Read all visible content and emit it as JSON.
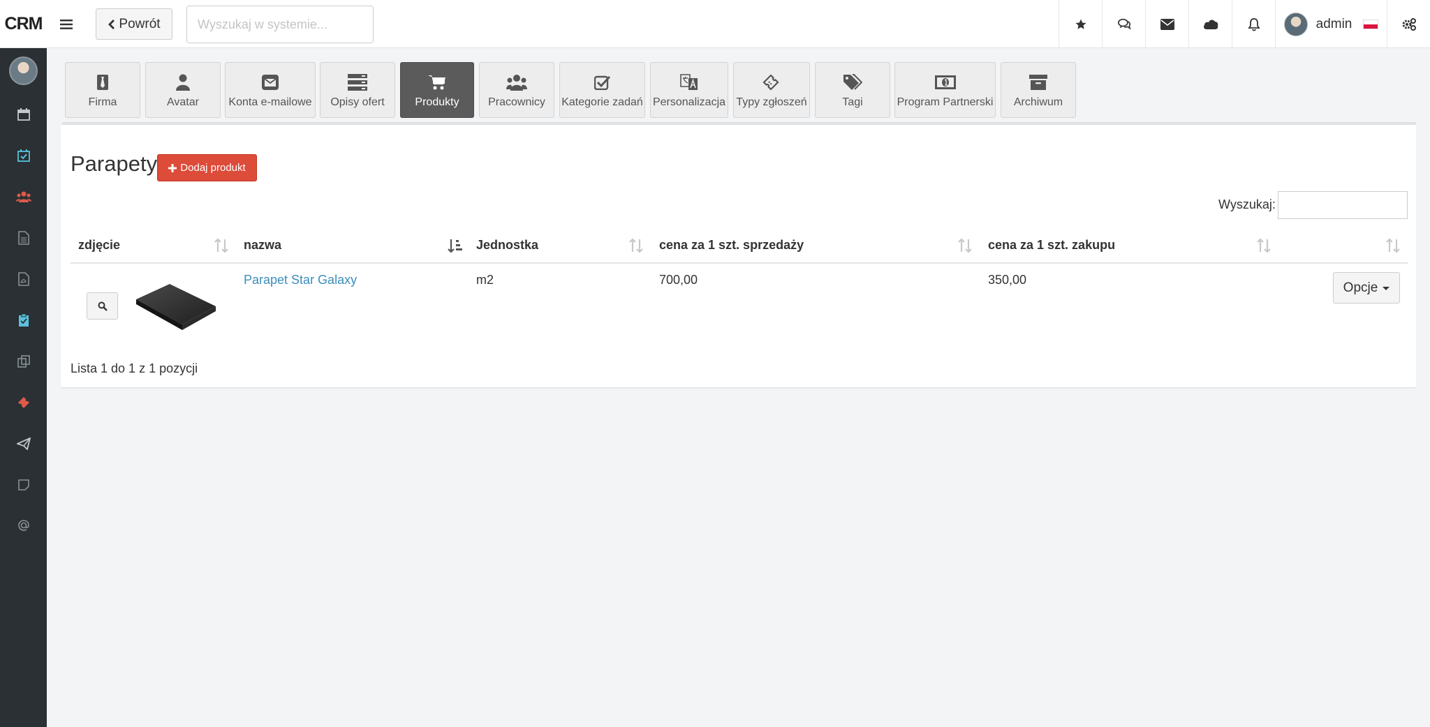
{
  "header": {
    "brand": "CRM",
    "back_label": "Powrót",
    "search_placeholder": "Wyszukaj w systemie...",
    "user_name": "admin",
    "icons": [
      "star-icon",
      "comments-icon",
      "envelope-icon",
      "cloud-icon",
      "bell-icon",
      "cogs-icon"
    ]
  },
  "sidebar": {
    "items": [
      {
        "icon": "calendar-icon",
        "color": "#c3c8cb"
      },
      {
        "icon": "calendar-check-icon",
        "color": "#5bc0de"
      },
      {
        "icon": "users-icon",
        "color": "#e05a4b"
      },
      {
        "icon": "document-icon",
        "color": "#8a9296"
      },
      {
        "icon": "pdf-icon",
        "color": "#8a9296"
      },
      {
        "icon": "clipboard-icon",
        "color": "#5bc0de"
      },
      {
        "icon": "copy-icon",
        "color": "#8a9296"
      },
      {
        "icon": "ticket-icon",
        "color": "#e05a4b"
      },
      {
        "icon": "paper-plane-icon",
        "color": "#c3c8cb"
      },
      {
        "icon": "note-icon",
        "color": "#8a9296"
      },
      {
        "icon": "at-icon",
        "color": "#8a9296"
      }
    ]
  },
  "tabs": [
    {
      "label": "Firma",
      "icon": "tie-icon",
      "active": false
    },
    {
      "label": "Avatar",
      "icon": "user-icon",
      "active": false
    },
    {
      "label": "Konta e-mailowe",
      "icon": "envelope-icon",
      "active": false
    },
    {
      "label": "Opisy ofert",
      "icon": "server-icon",
      "active": false
    },
    {
      "label": "Produkty",
      "icon": "cart-icon",
      "active": true
    },
    {
      "label": "Pracownicy",
      "icon": "users-icon",
      "active": false
    },
    {
      "label": "Kategorie zadań",
      "icon": "check-square-icon",
      "active": false
    },
    {
      "label": "Personalizacja",
      "icon": "language-icon",
      "active": false
    },
    {
      "label": "Typy zgłoszeń",
      "icon": "ticket-icon",
      "active": false
    },
    {
      "label": "Tagi",
      "icon": "tags-icon",
      "active": false
    },
    {
      "label": "Program Partnerski",
      "icon": "money-icon",
      "active": false
    },
    {
      "label": "Archiwum",
      "icon": "archive-icon",
      "active": false
    }
  ],
  "page": {
    "title": "Parapety",
    "add_button": "Dodaj produkt",
    "search_label": "Wyszukaj:",
    "search_value": ""
  },
  "table": {
    "columns": [
      "zdjęcie",
      "nazwa",
      "Jednostka",
      "cena za 1 szt. sprzedaży",
      "cena za 1 szt. zakupu",
      ""
    ],
    "rows": [
      {
        "name": "Parapet Star Galaxy",
        "unit": "m2",
        "sale_price": "700,00",
        "purchase_price": "350,00",
        "options": "Opcje"
      }
    ],
    "info": "Lista 1 do 1 z 1 pozycji"
  },
  "colors": {
    "sidebar_bg": "#2a3033",
    "active_tab": "#5b5b5b",
    "danger": "#dd4b39",
    "link": "#3c8dbc"
  }
}
